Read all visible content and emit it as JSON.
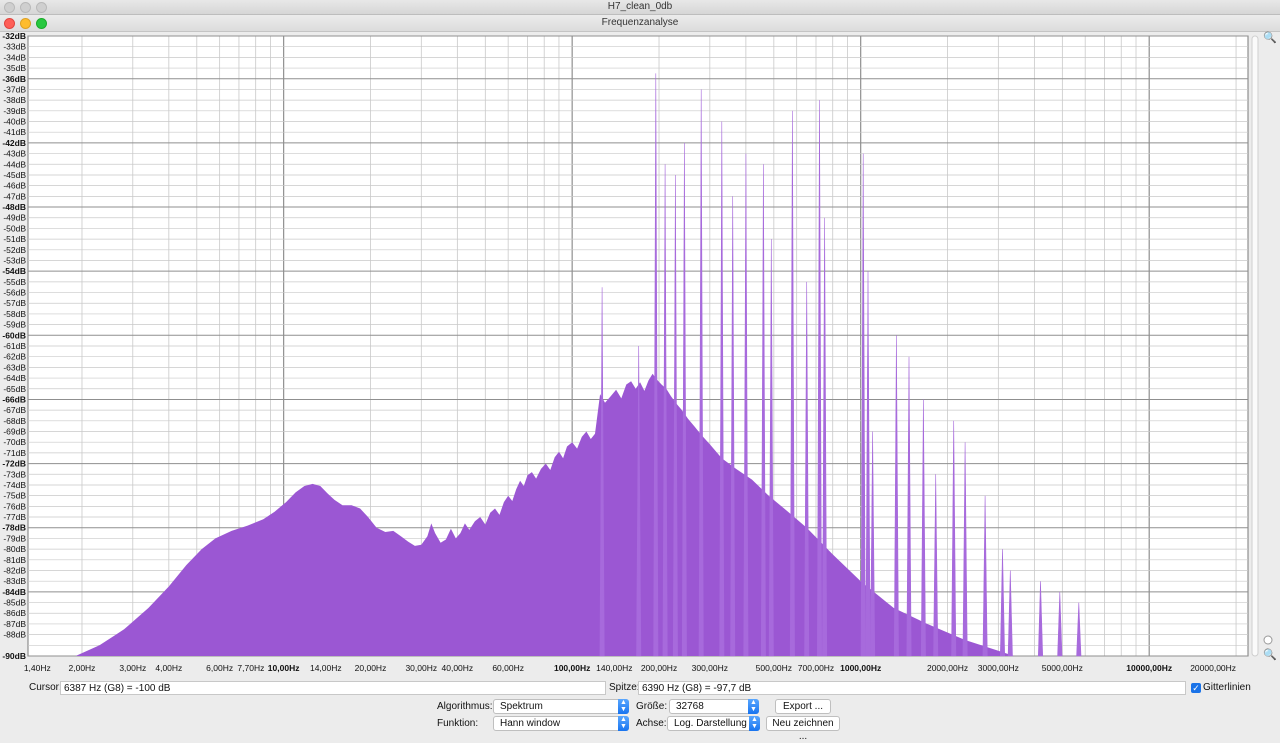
{
  "window": {
    "outer_title": "H7_clean_0db",
    "title": "Frequenzanalyse"
  },
  "chart_data": {
    "type": "area",
    "xscale": "log",
    "xlim": [
      1.3,
      22000
    ],
    "ylim": [
      -90,
      -32
    ],
    "y_ticks": [
      -32,
      -33,
      -34,
      -35,
      -36,
      -37,
      -38,
      -39,
      -40,
      -41,
      -42,
      -43,
      -44,
      -45,
      -46,
      -47,
      -48,
      -49,
      -50,
      -51,
      -52,
      -53,
      -54,
      -55,
      -56,
      -57,
      -58,
      -59,
      -60,
      -61,
      -62,
      -63,
      -64,
      -65,
      -66,
      -67,
      -68,
      -69,
      -70,
      -71,
      -72,
      -73,
      -74,
      -75,
      -76,
      -77,
      -78,
      -79,
      -80,
      -81,
      -82,
      -83,
      -84,
      -85,
      -86,
      -87,
      -88,
      -90
    ],
    "y_bold_ticks": [
      -32,
      -36,
      -42,
      -48,
      -54,
      -60,
      -66,
      -72,
      -78,
      -84,
      -90
    ],
    "x_ticks": [
      {
        "f": 1.4,
        "label": "1,40Hz",
        "bold": false
      },
      {
        "f": 2,
        "label": "2,00Hz",
        "bold": false
      },
      {
        "f": 3,
        "label": "3,00Hz",
        "bold": false
      },
      {
        "f": 4,
        "label": "4,00Hz",
        "bold": false
      },
      {
        "f": 6,
        "label": "6,00Hz",
        "bold": false
      },
      {
        "f": 7.7,
        "label": "7,70Hz",
        "bold": false
      },
      {
        "f": 10,
        "label": "10,00Hz",
        "bold": true
      },
      {
        "f": 14,
        "label": "14,00Hz",
        "bold": false
      },
      {
        "f": 20,
        "label": "20,00Hz",
        "bold": false
      },
      {
        "f": 30,
        "label": "30,00Hz",
        "bold": false
      },
      {
        "f": 40,
        "label": "40,00Hz",
        "bold": false
      },
      {
        "f": 60,
        "label": "60,00Hz",
        "bold": false
      },
      {
        "f": 100,
        "label": "100,00Hz",
        "bold": true
      },
      {
        "f": 140,
        "label": "140,00Hz",
        "bold": false
      },
      {
        "f": 200,
        "label": "200,00Hz",
        "bold": false
      },
      {
        "f": 300,
        "label": "300,00Hz",
        "bold": false
      },
      {
        "f": 500,
        "label": "500,00Hz",
        "bold": false
      },
      {
        "f": 700,
        "label": "700,00Hz",
        "bold": false
      },
      {
        "f": 1000,
        "label": "1000,00Hz",
        "bold": true
      },
      {
        "f": 2000,
        "label": "2000,00Hz",
        "bold": false
      },
      {
        "f": 3000,
        "label": "3000,00Hz",
        "bold": false
      },
      {
        "f": 5000,
        "label": "5000,00Hz",
        "bold": false
      },
      {
        "f": 10000,
        "label": "10000,00Hz",
        "bold": true
      },
      {
        "f": 20000,
        "label": "20000,00Hz",
        "bold": false
      }
    ],
    "envelope": [
      [
        1.9,
        -90
      ],
      [
        2.3,
        -89
      ],
      [
        2.8,
        -87.5
      ],
      [
        3.4,
        -85.5
      ],
      [
        4.0,
        -83.5
      ],
      [
        4.6,
        -81.5
      ],
      [
        5.2,
        -80
      ],
      [
        5.8,
        -79
      ],
      [
        6.6,
        -78.3
      ],
      [
        7.5,
        -77.8
      ],
      [
        8.5,
        -77.2
      ],
      [
        9.3,
        -76.5
      ],
      [
        10.2,
        -75.6
      ],
      [
        11.0,
        -74.7
      ],
      [
        11.8,
        -74.1
      ],
      [
        12.6,
        -73.9
      ],
      [
        13.4,
        -74.1
      ],
      [
        14.2,
        -74.8
      ],
      [
        15.0,
        -75.4
      ],
      [
        16.0,
        -75.9
      ],
      [
        17.2,
        -75.9
      ],
      [
        18.4,
        -76.2
      ],
      [
        19.6,
        -77
      ],
      [
        21.0,
        -78
      ],
      [
        22.5,
        -78.4
      ],
      [
        24.0,
        -78.3
      ],
      [
        25.5,
        -78.8
      ],
      [
        27.0,
        -79.3
      ],
      [
        28.5,
        -79.7
      ],
      [
        30.0,
        -79.6
      ],
      [
        31.5,
        -78.8
      ],
      [
        32.5,
        -77.6
      ],
      [
        33.5,
        -78.5
      ],
      [
        35.0,
        -79.4
      ],
      [
        36.5,
        -79.1
      ],
      [
        38.0,
        -78.1
      ],
      [
        39.5,
        -79
      ],
      [
        41.0,
        -78.5
      ],
      [
        42.5,
        -77.6
      ],
      [
        44.0,
        -78.2
      ],
      [
        46.0,
        -77.4
      ],
      [
        48.0,
        -77
      ],
      [
        50.0,
        -77.7
      ],
      [
        52.0,
        -76.6
      ],
      [
        54.0,
        -76.2
      ],
      [
        56.0,
        -76.8
      ],
      [
        58.0,
        -75.6
      ],
      [
        60.0,
        -75
      ],
      [
        62.0,
        -75.5
      ],
      [
        64.0,
        -74.4
      ],
      [
        66.0,
        -73.6
      ],
      [
        68.0,
        -74.1
      ],
      [
        70.0,
        -73.1
      ],
      [
        72.5,
        -72.8
      ],
      [
        75.0,
        -73.4
      ],
      [
        78.0,
        -72.5
      ],
      [
        81.0,
        -72
      ],
      [
        84.0,
        -72.6
      ],
      [
        87.0,
        -71.4
      ],
      [
        90.0,
        -70.9
      ],
      [
        93.0,
        -71.5
      ],
      [
        96.0,
        -70.4
      ],
      [
        100.0,
        -70
      ],
      [
        104.0,
        -70.6
      ],
      [
        108.0,
        -69.5
      ],
      [
        112.0,
        -69
      ],
      [
        116.0,
        -69.7
      ],
      [
        120.0,
        -69.2
      ],
      [
        125.0,
        -65.5
      ],
      [
        130.0,
        -66.3
      ],
      [
        136.0,
        -65.7
      ],
      [
        142.0,
        -65.1
      ],
      [
        148.0,
        -65.9
      ],
      [
        154.0,
        -64.6
      ],
      [
        160.0,
        -64.3
      ],
      [
        166.0,
        -65
      ],
      [
        172.0,
        -64.4
      ],
      [
        178.0,
        -65.2
      ],
      [
        184.0,
        -64.2
      ],
      [
        190.0,
        -63.6
      ],
      [
        196.0,
        -64.1
      ],
      [
        204.0,
        -64.6
      ],
      [
        212.0,
        -65
      ],
      [
        220.0,
        -65.7
      ],
      [
        230.0,
        -66.4
      ],
      [
        240.0,
        -67
      ],
      [
        252.0,
        -67.8
      ],
      [
        265.0,
        -68.5
      ],
      [
        280.0,
        -69.3
      ],
      [
        300.0,
        -70.2
      ],
      [
        330.0,
        -71.5
      ],
      [
        370.0,
        -72.5
      ],
      [
        420.0,
        -73.5
      ],
      [
        480.0,
        -75
      ],
      [
        560.0,
        -76.5
      ],
      [
        650.0,
        -78
      ],
      [
        800.0,
        -80.5
      ],
      [
        1000.0,
        -83
      ],
      [
        1300.0,
        -85.5
      ],
      [
        1700.0,
        -87
      ],
      [
        2300.0,
        -88.5
      ],
      [
        3000.0,
        -89.5
      ],
      [
        3400.0,
        -90
      ]
    ],
    "peaks": [
      [
        127,
        -55.5
      ],
      [
        170,
        -61
      ],
      [
        195,
        -35.5
      ],
      [
        210,
        -44
      ],
      [
        228,
        -45
      ],
      [
        245,
        -42
      ],
      [
        280,
        -37
      ],
      [
        330,
        -40
      ],
      [
        360,
        -47
      ],
      [
        400,
        -43
      ],
      [
        460,
        -44
      ],
      [
        490,
        -51
      ],
      [
        580,
        -39
      ],
      [
        650,
        -55
      ],
      [
        720,
        -38
      ],
      [
        750,
        -49
      ],
      [
        1020,
        -43
      ],
      [
        1060,
        -54
      ],
      [
        1100,
        -69
      ],
      [
        1330,
        -60
      ],
      [
        1470,
        -62
      ],
      [
        1650,
        -66
      ],
      [
        1820,
        -73
      ],
      [
        2100,
        -68
      ],
      [
        2300,
        -70
      ],
      [
        2700,
        -75
      ],
      [
        3100,
        -80
      ],
      [
        3300,
        -82
      ],
      [
        4200,
        -83
      ],
      [
        4900,
        -84
      ],
      [
        5700,
        -85
      ]
    ]
  },
  "status": {
    "cursor_label": "Cursor:",
    "cursor_value": "6387 Hz (G8) = -100 dB",
    "peak_label": "Spitze:",
    "peak_value": "6390 Hz (G8) = -97,7 dB",
    "grid_label": "Gitterlinien",
    "grid_checked": true
  },
  "controls": {
    "algorithm_label": "Algorithmus:",
    "algorithm_value": "Spektrum",
    "size_label": "Größe:",
    "size_value": "32768",
    "export_label": "Export ...",
    "function_label": "Funktion:",
    "function_value": "Hann window",
    "axis_label": "Achse:",
    "axis_value": "Log. Darstellung",
    "redraw_label": "Neu zeichnen ..."
  },
  "colors": {
    "fill": "#9b57d3",
    "peak": "#a76adc",
    "grid_minor": "#c9c9c9",
    "grid_major": "#8f8f8f"
  },
  "icons": [
    "zoom-in-icon",
    "zoom-out-icon",
    "checkbox-icon",
    "chevron-updown-icon"
  ]
}
